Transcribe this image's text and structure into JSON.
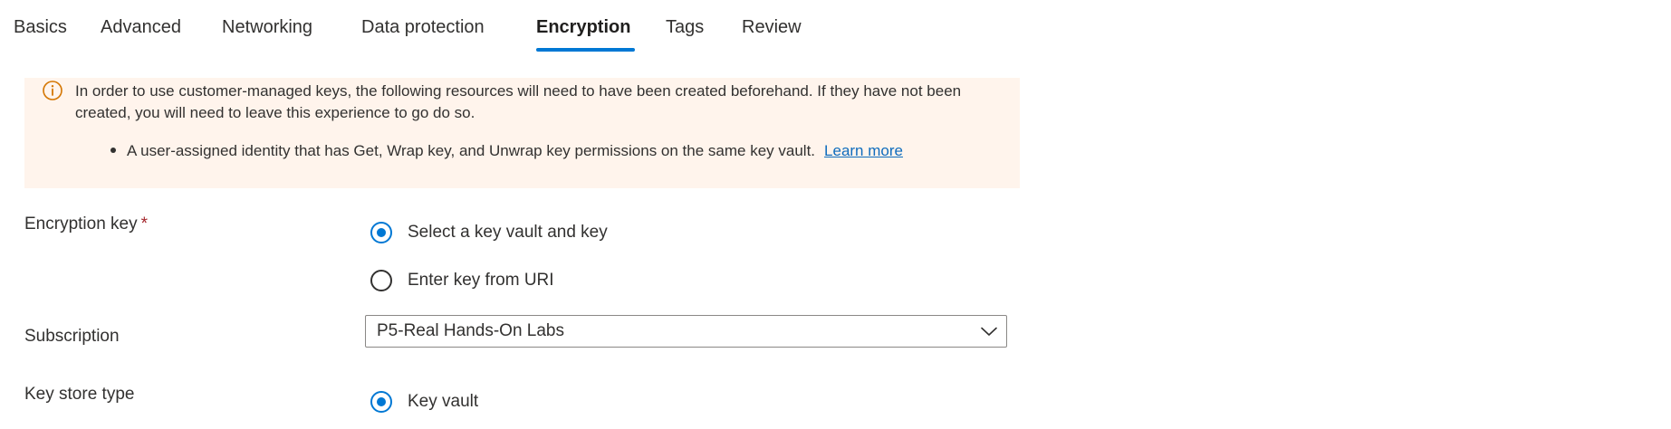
{
  "tabs": [
    {
      "label": "Basics"
    },
    {
      "label": "Advanced"
    },
    {
      "label": "Networking"
    },
    {
      "label": "Data protection"
    },
    {
      "label": "Encryption"
    },
    {
      "label": "Tags"
    },
    {
      "label": "Review"
    }
  ],
  "active_tab": "Encryption",
  "banner": {
    "icon": "info-icon",
    "text": "In order to use customer-managed keys, the following resources will need to have been created beforehand. If they have not been created, you will need to leave this experience to go do so.",
    "bullet": "A user-assigned identity that has Get, Wrap key, and Unwrap key permissions on the same key vault.",
    "link": "Learn more",
    "background_color": "#fff4ec",
    "icon_color": "#d47500"
  },
  "form": {
    "encryption_key": {
      "label": "Encryption key",
      "required_marker": "*",
      "options": [
        {
          "label": "Select a key vault and key",
          "checked": true
        },
        {
          "label": "Enter key from URI",
          "checked": false
        }
      ]
    },
    "subscription": {
      "label": "Subscription",
      "value": "P5-Real Hands-On Labs"
    },
    "key_store_type": {
      "label": "Key store type",
      "options": [
        {
          "label": "Key vault",
          "checked": true
        }
      ]
    }
  },
  "colors": {
    "accent": "#0078d4",
    "link": "#0f6cbd",
    "required": "#a4262c"
  }
}
